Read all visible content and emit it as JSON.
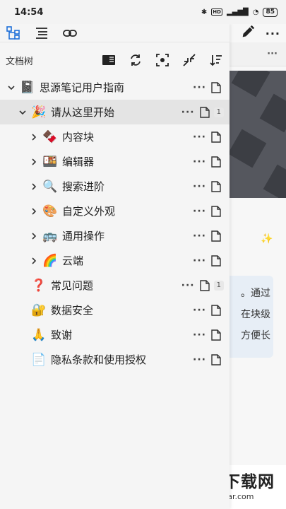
{
  "statusbar": {
    "time": "14:54",
    "battery": "85"
  },
  "panel": {
    "title": "文档树"
  },
  "tree": {
    "root": {
      "label": "思源笔记用户指南",
      "emoji": "📓"
    },
    "items": [
      {
        "label": "请从这里开始",
        "emoji": "🎉",
        "count": "1"
      },
      {
        "label": "内容块",
        "emoji": "🍫"
      },
      {
        "label": "编辑器",
        "emoji": "🍱"
      },
      {
        "label": "搜索进阶",
        "emoji": "🔍"
      },
      {
        "label": "自定义外观",
        "emoji": "🎨"
      },
      {
        "label": "通用操作",
        "emoji": "🚌"
      },
      {
        "label": "云端",
        "emoji": "🌈"
      },
      {
        "label": "常见问题",
        "emoji": "❓",
        "count": "1"
      },
      {
        "label": "数据安全",
        "emoji": "🔐"
      },
      {
        "label": "致谢",
        "emoji": "🙏"
      },
      {
        "label": "隐私条款和使用授权",
        "emoji": "📄"
      }
    ]
  },
  "editor": {
    "callout": [
      "。通过",
      "在块级",
      "方便长"
    ],
    "more": "···"
  },
  "watermark": {
    "title": "菊花下载网",
    "url": "www.juahar.com"
  }
}
